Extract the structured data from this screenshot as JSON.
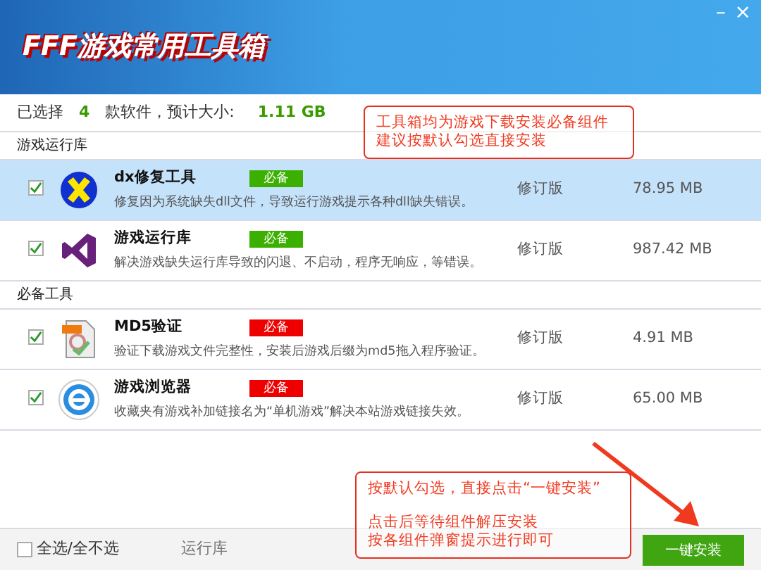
{
  "window": {
    "title": "FFF游戏常用工具箱",
    "controls": [
      "–",
      "×"
    ]
  },
  "summary": {
    "label_selected": "已选择",
    "count": "4",
    "label_size": "款软件，预计大小:",
    "size": "1.11 GB"
  },
  "sections": [
    {
      "title": "游戏运行库",
      "items": [
        {
          "kind": "dx",
          "name": "dx修复工具",
          "badge": "必备",
          "color": "#3cb000",
          "description": "修复因为系统缺失dll文件，导致运行游戏提示各种dll缺失错误。",
          "version": "修订版",
          "size": "78.95 MB",
          "checked": true,
          "selected": true
        },
        {
          "kind": "vs",
          "name": "游戏运行库",
          "badge": "必备",
          "color": "#3cb000",
          "description": "解决游戏缺失运行库导致的闪退、不启动，程序无响应，等错误。",
          "version": "修订版",
          "size": "987.42 MB",
          "checked": true,
          "selected": false
        }
      ]
    },
    {
      "title": "必备工具",
      "items": [
        {
          "kind": "md5",
          "name": "MD5验证",
          "badge": "必备",
          "color": "#ee0000",
          "description": "验证下载游戏文件完整性，安装后游戏后缀为md5拖入程序验证。",
          "version": "修订版",
          "size": "4.91 MB",
          "checked": true,
          "selected": false
        },
        {
          "kind": "browser",
          "name": "游戏浏览器",
          "badge": "必备",
          "color": "#ee0000",
          "description": "收藏夹有游戏补加链接名为“单机游戏”解决本站游戏链接失效。",
          "version": "修订版",
          "size": "65.00 MB",
          "checked": true,
          "selected": false
        }
      ]
    }
  ],
  "footer": {
    "select_all": {
      "label": "全选/全不选",
      "checked": false
    },
    "tab": "运行库",
    "install_button": "一键安装"
  },
  "annotations": [
    {
      "paragraphs": [
        [
          "工具箱均为游戏下载安装必备组件",
          "建议按默认勾选直接安装"
        ]
      ]
    },
    {
      "paragraphs": [
        [
          "按默认勾选，直接点击“一键安装”"
        ],
        [
          "点击后等待组件解压安装",
          "按各组件弹窗提示进行即可"
        ]
      ]
    }
  ]
}
